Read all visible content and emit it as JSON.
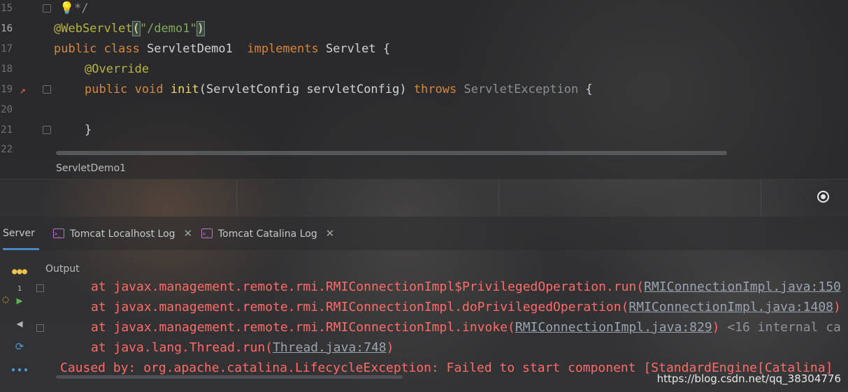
{
  "editor": {
    "lines": [
      {
        "num": "15"
      },
      {
        "num": "16",
        "annotation": "@WebServlet",
        "open": "(",
        "string": "\"/demo1\"",
        "close": ")"
      },
      {
        "num": "17",
        "kw1": "public class",
        "name": " ServletDemo1  ",
        "kw2": "implements",
        "rest": " Servlet {"
      },
      {
        "num": "18",
        "annotation": "@Override"
      },
      {
        "num": "19",
        "kw1": "public void",
        "fn": "init",
        "params": "(ServletConfig servletConfig) ",
        "kw2": "throws",
        "exc": " ServletException",
        "brace": " {"
      },
      {
        "num": "20"
      },
      {
        "num": "21",
        "brace": "}"
      },
      {
        "num": "22"
      }
    ],
    "comment_end": "*/",
    "breadcrumb": "ServletDemo1"
  },
  "tabs": [
    {
      "label": "Server",
      "active": true
    },
    {
      "label": "Tomcat Localhost Log"
    },
    {
      "label": "Tomcat Catalina Log"
    }
  ],
  "run_panel": {
    "output_label": "Output",
    "deploy_count": "1"
  },
  "console": {
    "lines": [
      {
        "prefix": "at javax.management.remote.rmi.RMIConnectionImpl$PrivilegedOperation.run(",
        "link": "RMIConnectionImpl.java:150",
        "suffix": ""
      },
      {
        "prefix": "at javax.management.remote.rmi.RMIConnectionImpl.doPrivilegedOperation(",
        "link": "RMIConnectionImpl.java:1408",
        "suffix": ")"
      },
      {
        "prefix": "at javax.management.remote.rmi.RMIConnectionImpl.invoke(",
        "link": "RMIConnectionImpl.java:829",
        "suffix": ")",
        "extra": " <16 internal ca"
      },
      {
        "prefix": "at java.lang.Thread.run(",
        "link": "Thread.java:748",
        "suffix": ")"
      }
    ],
    "caused_by": "Caused by: org.apache.catalina.LifecycleException: Failed to start component [StandardEngine[Catalina]"
  },
  "watermark": "https://blog.csdn.net/qq_38304776",
  "colors": {
    "keyword": "#d6873e",
    "annotation": "#b7b43f",
    "string": "#7fa95e",
    "error": "#ff6b68",
    "tab_active": "#4a86c8"
  }
}
